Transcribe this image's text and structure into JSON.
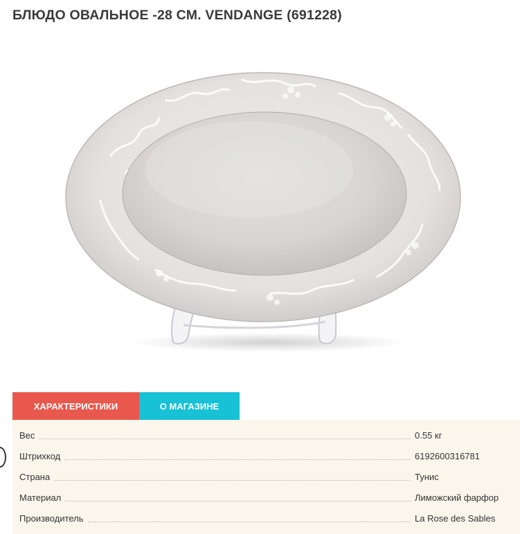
{
  "product": {
    "title": "БЛЮДО ОВАЛЬНОЕ -28 СМ. VENDANGE (691228)"
  },
  "tabs": [
    {
      "label": "ХАРАКТЕРИСТИКИ",
      "active": true
    },
    {
      "label": "О МАГАЗИНЕ",
      "active": false
    }
  ],
  "specs": [
    {
      "name": "Вес",
      "value": "0.55 кг"
    },
    {
      "name": "Штрихкод",
      "value": "6192600316781"
    },
    {
      "name": "Страна",
      "value": "Тунис"
    },
    {
      "name": "Материал",
      "value": "Лиможский фарфор"
    },
    {
      "name": "Производитель",
      "value": "La Rose des Sables"
    }
  ],
  "colors": {
    "tab_active": "#e8584c",
    "tab_inactive": "#17c1d6",
    "panel_background": "#faf6ec",
    "title_text": "#3a3a3a"
  }
}
